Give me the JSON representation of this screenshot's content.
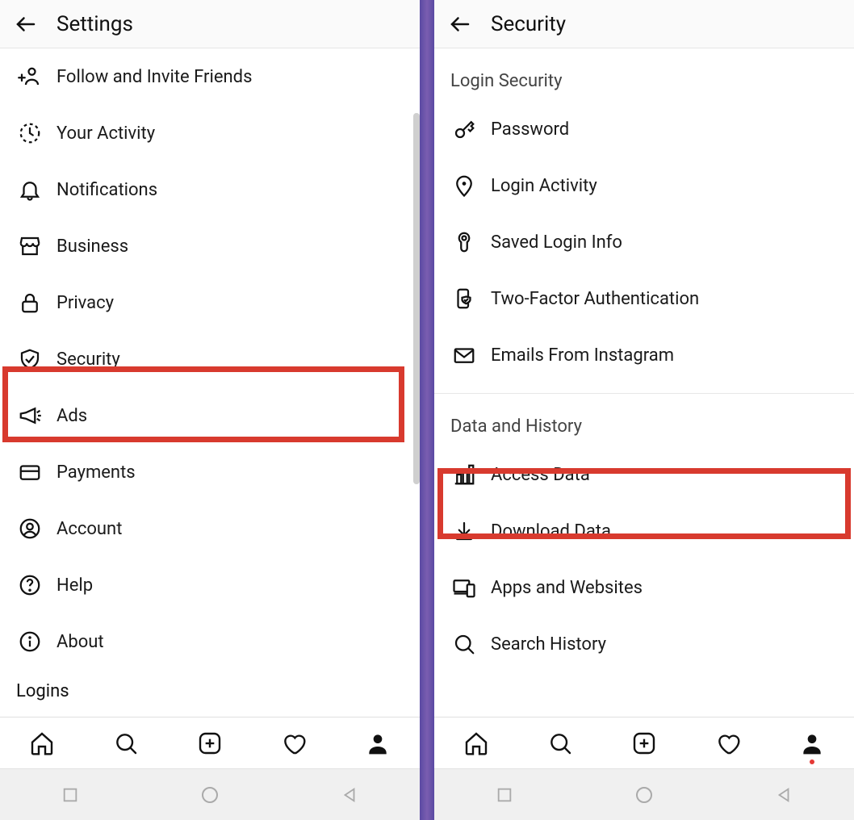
{
  "left": {
    "header": {
      "title": "Settings"
    },
    "items": [
      {
        "id": "follow-invite",
        "label": "Follow and Invite Friends",
        "icon": "add-person-icon"
      },
      {
        "id": "your-activity",
        "label": "Your Activity",
        "icon": "clock-dashed-icon"
      },
      {
        "id": "notifications",
        "label": "Notifications",
        "icon": "bell-icon"
      },
      {
        "id": "business",
        "label": "Business",
        "icon": "storefront-icon"
      },
      {
        "id": "privacy",
        "label": "Privacy",
        "icon": "lock-icon"
      },
      {
        "id": "security",
        "label": "Security",
        "icon": "shield-check-icon",
        "highlight": true
      },
      {
        "id": "ads",
        "label": "Ads",
        "icon": "megaphone-icon"
      },
      {
        "id": "payments",
        "label": "Payments",
        "icon": "credit-card-icon"
      },
      {
        "id": "account",
        "label": "Account",
        "icon": "user-circle-icon"
      },
      {
        "id": "help",
        "label": "Help",
        "icon": "help-circle-icon"
      },
      {
        "id": "about",
        "label": "About",
        "icon": "info-circle-icon"
      }
    ],
    "sections": {
      "logins": "Logins"
    }
  },
  "right": {
    "header": {
      "title": "Security"
    },
    "sections": {
      "login_security": "Login Security",
      "data_history": "Data and History"
    },
    "login_items": [
      {
        "id": "password",
        "label": "Password",
        "icon": "key-icon"
      },
      {
        "id": "login-activity",
        "label": "Login Activity",
        "icon": "location-pin-icon"
      },
      {
        "id": "saved-login",
        "label": "Saved Login Info",
        "icon": "keyhole-icon"
      },
      {
        "id": "two-factor",
        "label": "Two-Factor Authentication",
        "icon": "phone-shield-icon"
      },
      {
        "id": "emails-ig",
        "label": "Emails From Instagram",
        "icon": "mail-icon"
      }
    ],
    "data_items": [
      {
        "id": "access-data",
        "label": "Access Data",
        "icon": "bar-chart-icon",
        "highlight": true
      },
      {
        "id": "download-data",
        "label": "Download Data",
        "icon": "download-icon"
      },
      {
        "id": "apps-websites",
        "label": "Apps and Websites",
        "icon": "devices-icon"
      },
      {
        "id": "search-history",
        "label": "Search History",
        "icon": "search-icon"
      }
    ]
  }
}
